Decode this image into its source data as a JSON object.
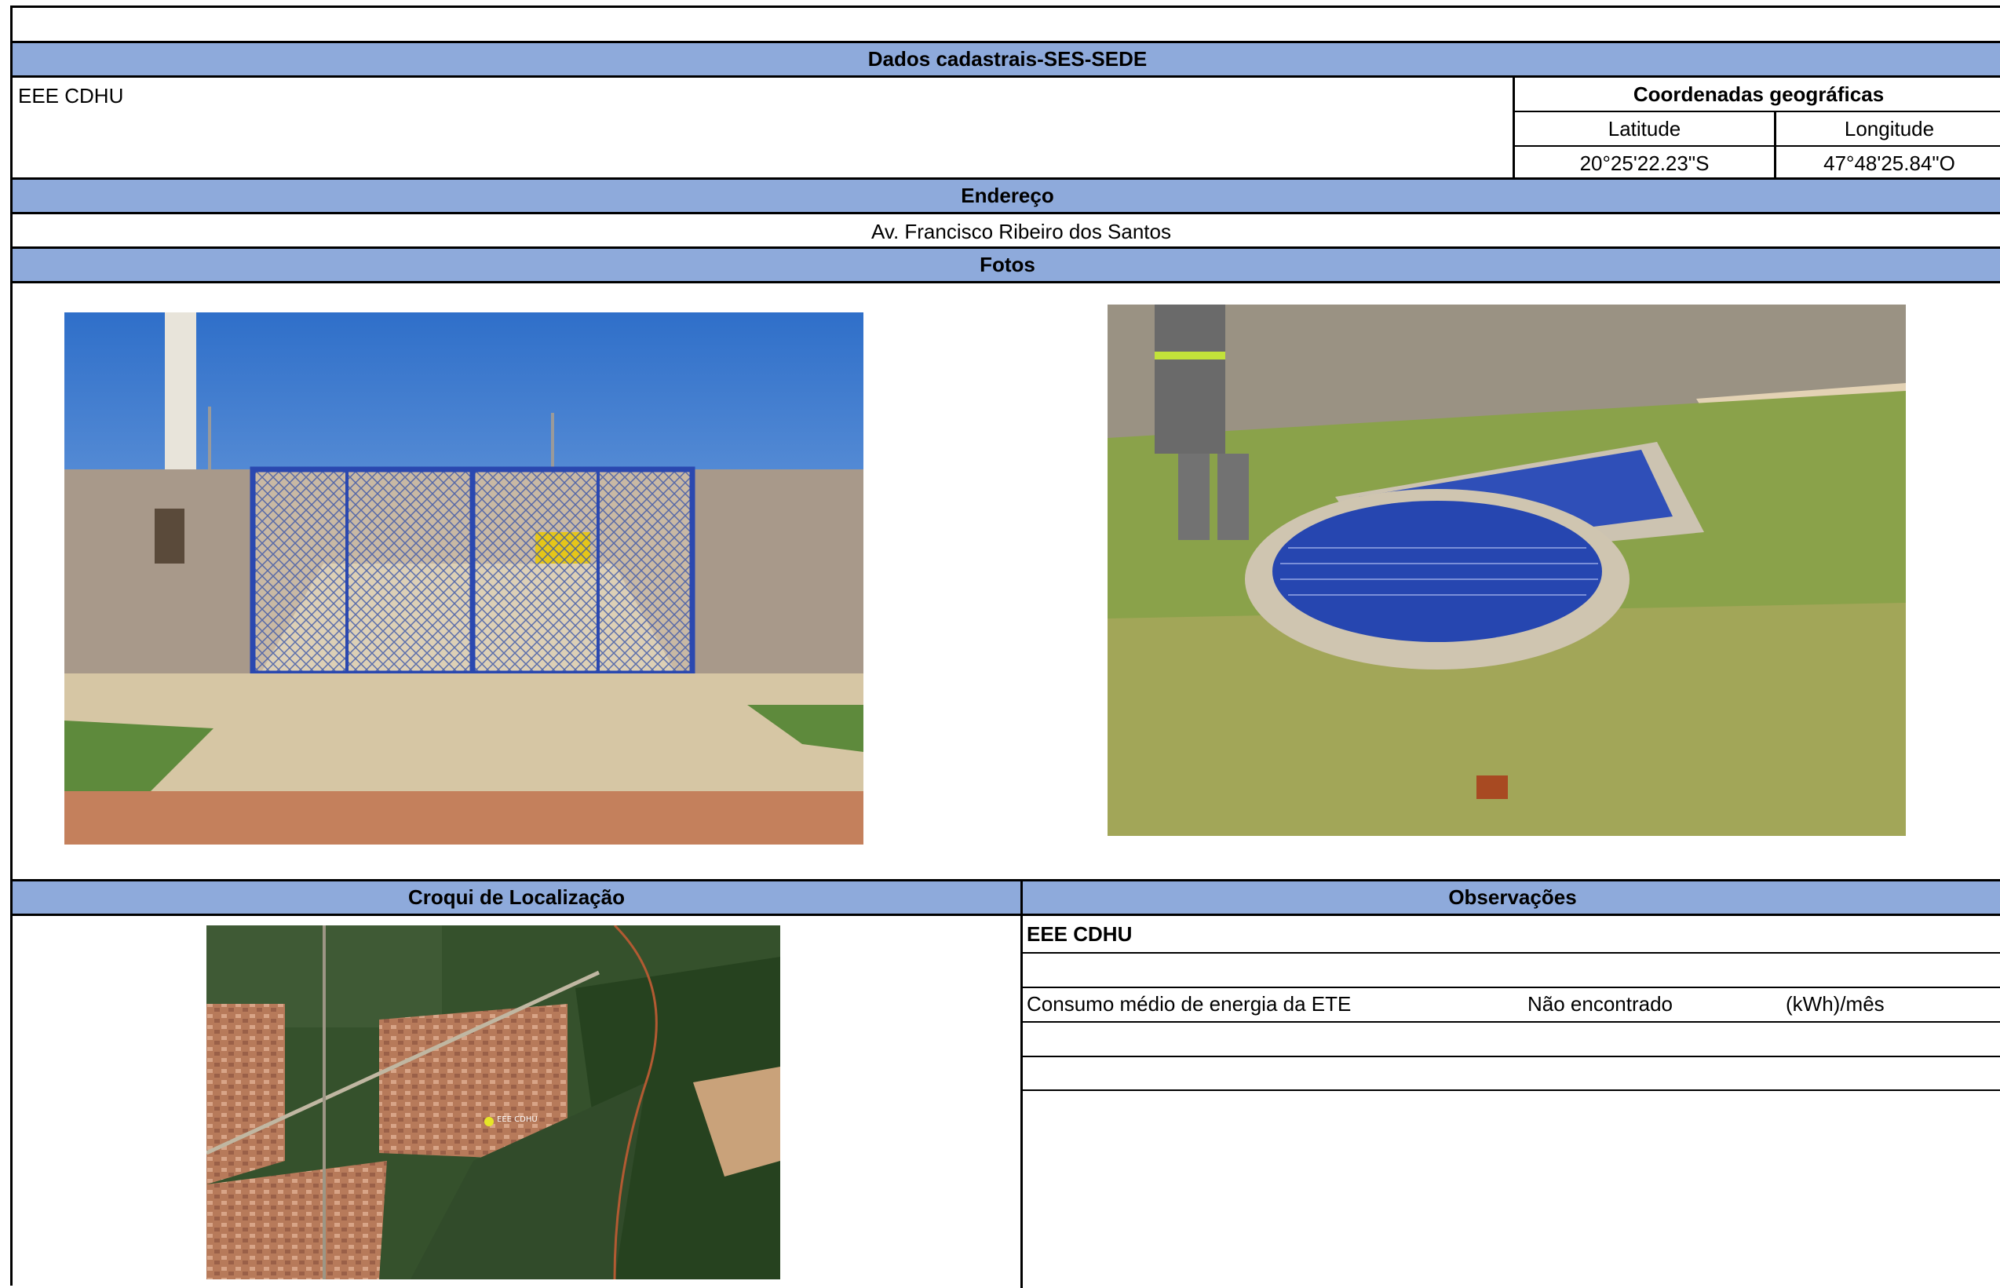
{
  "header": {
    "title": "Dados cadastrais-SES-SEDE"
  },
  "facility": {
    "name": "EEE CDHU"
  },
  "coordinates": {
    "heading": "Coordenadas geográficas",
    "latitude_label": "Latitude",
    "longitude_label": "Longitude",
    "latitude_value": "20°25'22.23\"S",
    "longitude_value": "47°48'25.84\"O"
  },
  "address": {
    "heading": "Endereço",
    "value": "Av. Francisco Ribeiro dos Santos"
  },
  "photos": {
    "heading": "Fotos"
  },
  "location_sketch": {
    "heading": "Croqui de Localização",
    "map_marker_label": "EEE CDHU"
  },
  "observations": {
    "heading": "Observações",
    "title": "EEE CDHU",
    "energy_label": "Consumo médio de energia da ETE",
    "energy_value": "Não encontrado",
    "energy_unit": "(kWh)/mês"
  },
  "colors": {
    "band_fill": "#8eaadb",
    "grid_lines": "#000000"
  }
}
